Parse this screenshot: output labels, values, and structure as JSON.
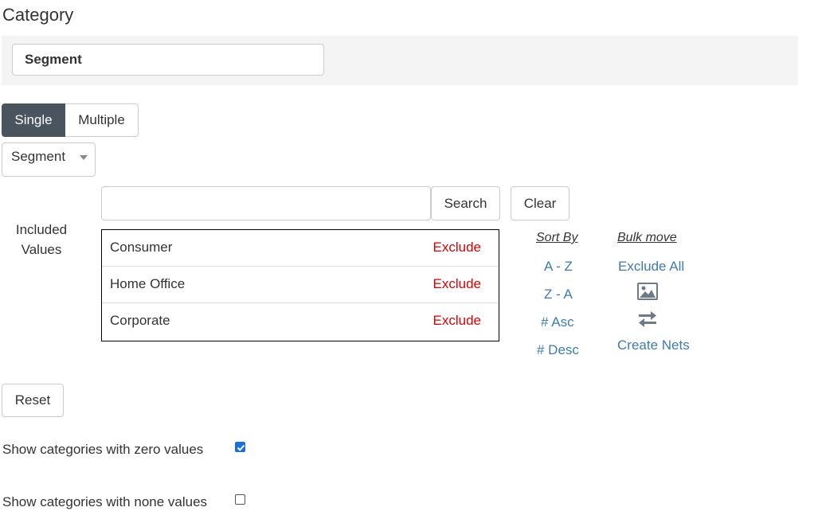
{
  "page": {
    "title": "Category"
  },
  "category": {
    "value": "Segment"
  },
  "mode": {
    "single_label": "Single",
    "multiple_label": "Multiple",
    "selected": "Single"
  },
  "dropdown": {
    "selected": "Segment"
  },
  "search": {
    "value": "",
    "button_label": "Search",
    "clear_label": "Clear"
  },
  "included": {
    "label": "Included Values",
    "items": [
      {
        "name": "Consumer",
        "action": "Exclude"
      },
      {
        "name": "Home Office",
        "action": "Exclude"
      },
      {
        "name": "Corporate",
        "action": "Exclude"
      }
    ]
  },
  "sort": {
    "header": "Sort By",
    "options": [
      "A - Z",
      "Z - A",
      "# Asc",
      "# Desc"
    ]
  },
  "bulk": {
    "header": "Bulk move",
    "exclude_all": "Exclude All",
    "image_icon": "image-icon",
    "swap_icon": "swap-arrows-icon",
    "create_nets": "Create Nets"
  },
  "reset": {
    "label": "Reset"
  },
  "options": {
    "zero_values": {
      "label": "Show categories with zero values",
      "checked": true
    },
    "none_values": {
      "label": "Show categories with none values",
      "checked": false
    }
  },
  "colors": {
    "single_active_bg": "#4a545e",
    "exclude_red": "#dd0000",
    "link_blue": "#3d7bb0",
    "checkbox_blue": "#1a6fe0"
  }
}
